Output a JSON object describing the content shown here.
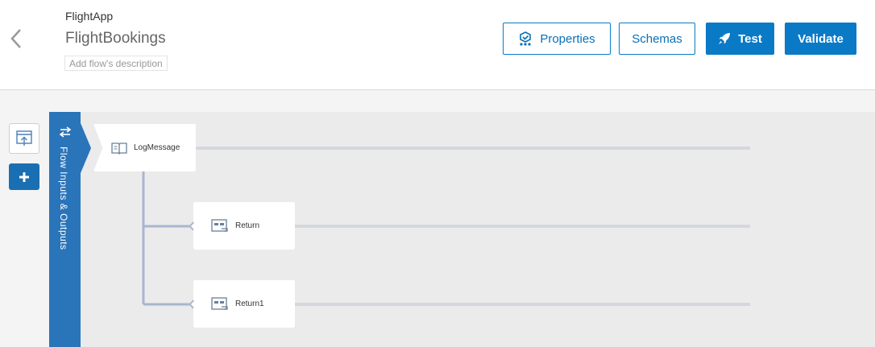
{
  "header": {
    "app_name": "FlightApp",
    "flow_title": "FlightBookings",
    "flow_description_placeholder": "Add flow's description"
  },
  "buttons": {
    "properties": "Properties",
    "schemas": "Schemas",
    "test": "Test",
    "validate": "Validate"
  },
  "io_panel": {
    "label": "Flow Inputs & Outputs"
  },
  "tiles": [
    {
      "label": "LogMessage",
      "icon": "book-icon"
    },
    {
      "label": "Return",
      "icon": "return-icon"
    },
    {
      "label": "Return1",
      "icon": "return-icon"
    }
  ],
  "colors": {
    "accent": "#0a7ac6",
    "io_bar": "#2a74b9",
    "connector": "#a8b6cf",
    "lane": "#d4d7de"
  }
}
